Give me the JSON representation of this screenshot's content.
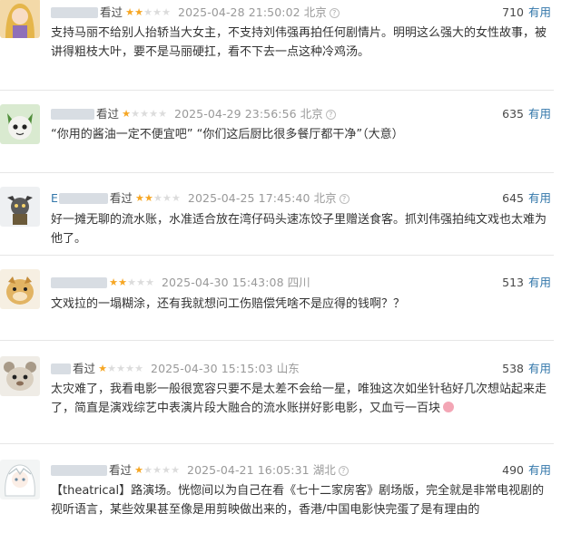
{
  "vote_label": "有用",
  "watched_label": "看过",
  "colors": {
    "star": "#f6a623",
    "link": "#3377aa",
    "muted": "#999999"
  },
  "reviews": [
    {
      "user_initial": "",
      "rating": 2,
      "time": "2025-04-28 21:50:02",
      "location": "北京",
      "votes": "710",
      "content": "支持马丽不给别人抬轿当大女主，不支持刘伟强再拍任何剧情片。明明这么强大的女性故事，被讲得粗枝大叶，要不是马丽硬扛，看不下去一点这种冷鸡汤。"
    },
    {
      "user_initial": "",
      "rating": 1,
      "time": "2025-04-29 23:56:56",
      "location": "北京",
      "votes": "635",
      "content": "“你用的酱油一定不便宜吧” “你们这后厨比很多餐厅都干净”（大意）"
    },
    {
      "user_initial": "E",
      "rating": 2,
      "time": "2025-04-25 17:45:40",
      "location": "北京",
      "votes": "645",
      "content": "好一摊无聊的流水账，水准适合放在湾仔码头速冻饺子里赠送食客。抓刘伟强拍纯文戏也太难为他了。"
    },
    {
      "user_initial": "",
      "rating": 2,
      "time": "2025-04-30 15:43:08",
      "location": "四川",
      "votes": "513",
      "content": "文戏拉的一塌糊涂，还有我就想问工伤赔偿凭啥不是应得的钱啊？？"
    },
    {
      "user_initial": "",
      "rating": 1,
      "time": "2025-04-30 15:15:03",
      "location": "山东",
      "votes": "538",
      "content": "太灾难了，我看电影一般很宽容只要不是太差不会给一星，唯独这次如坐针毡好几次想站起来走了，简直是演戏综艺中表演片段大融合的流水账拼好影电影，又血亏一百块"
    },
    {
      "user_initial": "",
      "rating": 1,
      "time": "2025-04-21 16:05:31",
      "location": "湖北",
      "votes": "490",
      "content": "【theatrical】路演场。恍惚间以为自己在看《七十二家房客》剧场版，完全就是非常电视剧的视听语言，某些效果甚至像是用剪映做出来的，香港/中国电影快完蛋了是有理由的"
    }
  ]
}
